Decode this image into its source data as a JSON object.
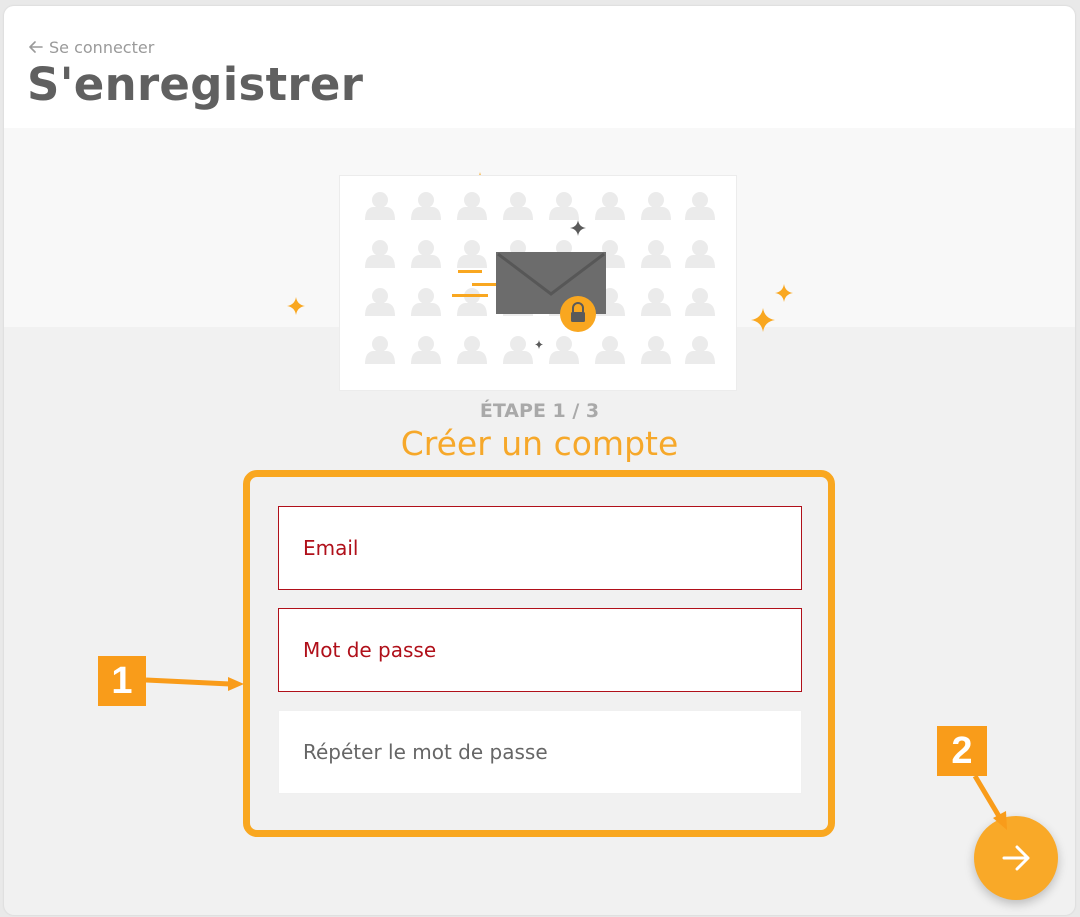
{
  "header": {
    "back_label": "Se connecter",
    "title": "S'enregistrer"
  },
  "step": {
    "label": "ÉTAPE 1 / 3",
    "title": "Créer un compte"
  },
  "form": {
    "email_placeholder": "Email",
    "password_placeholder": "Mot de passe",
    "repeat_placeholder": "Répéter le mot de passe"
  },
  "annotations": {
    "badge_1": "1",
    "badge_2": "2"
  },
  "icons": {
    "back": "arrow-left-icon",
    "next": "arrow-right-icon",
    "illustration": "envelope-lock-icon"
  },
  "colors": {
    "accent": "#f9a720",
    "error": "#b0101a",
    "title": "#606060"
  }
}
